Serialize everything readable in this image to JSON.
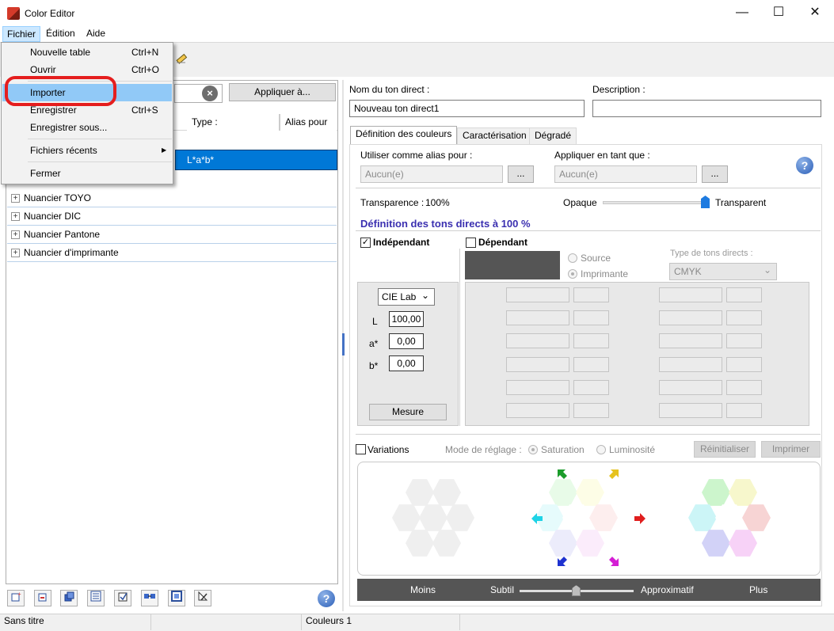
{
  "window": {
    "title": "Color Editor",
    "minimize": "—",
    "maximize": "☐",
    "close": "✕"
  },
  "menubar": {
    "items": [
      "Fichier",
      "Édition",
      "Aide"
    ]
  },
  "file_menu": {
    "items": [
      {
        "label": "Nouvelle table",
        "shortcut": "Ctrl+N"
      },
      {
        "label": "Ouvrir",
        "shortcut": "Ctrl+O"
      },
      {
        "label": "Importer",
        "shortcut": ""
      },
      {
        "label": "Enregistrer",
        "shortcut": "Ctrl+S"
      },
      {
        "label": "Enregistrer sous...",
        "shortcut": ""
      },
      {
        "label": "Fichiers récents",
        "shortcut": ""
      },
      {
        "label": "Fermer",
        "shortcut": ""
      }
    ],
    "submenu_arrow": "▶"
  },
  "left": {
    "apply_button": "Appliquer à...",
    "clear_icon": "×",
    "columns": [
      "Type :",
      "Alias pour"
    ],
    "selected_type": "L*a*b*",
    "tree": [
      "Nuancier TOYO",
      "Nuancier DIC",
      "Nuancier Pantone",
      "Nuancier d'imprimante"
    ],
    "expand_glyph": "+",
    "bottom_icons": [
      "add-color-icon",
      "delete-color-icon",
      "duplicate-icon",
      "list-view-icon",
      "check-icon",
      "link-icon",
      "frame-icon",
      "edit-icon"
    ],
    "help": "?"
  },
  "right": {
    "spot_name_label": "Nom du ton direct :",
    "spot_name_value": "Nouveau ton direct1",
    "description_label": "Description :",
    "description_value": "",
    "tabs": [
      "Définition des couleurs",
      "Caractérisation",
      "Dégradé"
    ],
    "alias_label": "Utiliser comme alias pour :",
    "alias_value": "Aucun(e)",
    "apply_as_label": "Appliquer en tant que :",
    "apply_as_value": "Aucun(e)",
    "ellipsis": "...",
    "help": "?",
    "transparency_label": "Transparence :",
    "transparency_value": "100%",
    "opaque": "Opaque",
    "transparent": "Transparent",
    "transparency_level": 1.0,
    "section_title": "Définition des tons directs à 100 %",
    "independent": "Indépendant",
    "dependent": "Dépendant",
    "check_mark": "✓",
    "source": "Source",
    "printer": "Imprimante",
    "spot_type_label": "Type de tons directs :",
    "spot_type_value": "CMYK",
    "color_space": "CIE Lab",
    "lab": [
      {
        "label": "L",
        "value": "100,00"
      },
      {
        "label": "a*",
        "value": "0,00"
      },
      {
        "label": "b*",
        "value": "0,00"
      }
    ],
    "measure": "Mesure",
    "chevron": "⌄",
    "variations": "Variations",
    "mode_label": "Mode de réglage :",
    "saturation": "Saturation",
    "luminosity": "Luminosité",
    "reset": "Réinitialiser",
    "print": "Imprimer",
    "scale": {
      "less": "Moins",
      "fine": "Subtil",
      "approx": "Approximatif",
      "more": "Plus",
      "level": 0.5
    }
  },
  "status": {
    "doc": "Sans titre",
    "count": "Couleurs 1"
  },
  "colors": {
    "accent": "#0078d7",
    "section_title": "#3a2fb0",
    "slider_thumb": "#1e7be0",
    "dark_swatch": "#555555"
  }
}
